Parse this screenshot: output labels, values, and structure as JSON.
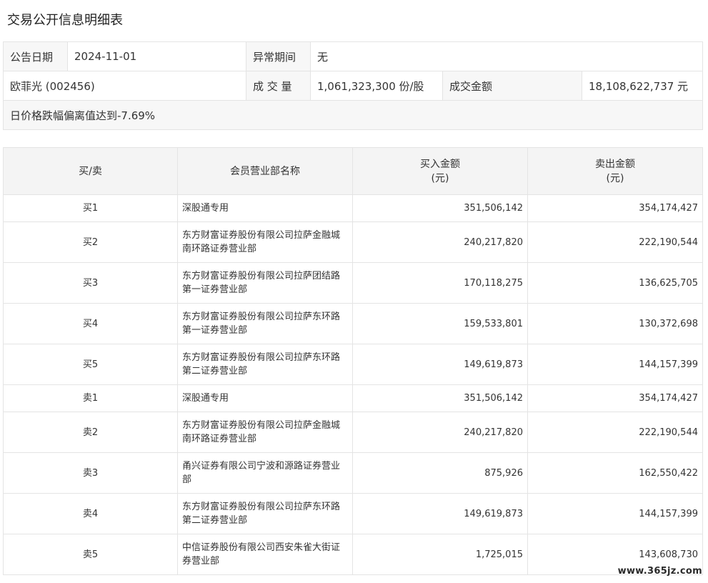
{
  "page_title": "交易公开信息明细表",
  "summary": {
    "date_label": "公告日期",
    "date_value": "2024-11-01",
    "abnormal_period_label": "异常期间",
    "abnormal_period_value": "无",
    "stock": "欧菲光 (002456)",
    "volume_label": "成 交 量",
    "volume_value": "1,061,323,300 份/股",
    "amount_label": "成交金额",
    "amount_value": "18,108,622,737 元",
    "note": "日价格跌幅偏离值达到-7.69%"
  },
  "table": {
    "headers": {
      "side": "买/卖",
      "member": "会员营业部名称",
      "buy_line1": "买入金额",
      "buy_line2": "(元)",
      "sell_line1": "卖出金额",
      "sell_line2": "(元)"
    },
    "rows": [
      {
        "side": "买1",
        "name": "深股通专用",
        "buy": "351,506,142",
        "sell": "354,174,427"
      },
      {
        "side": "买2",
        "name": "东方财富证券股份有限公司拉萨金融城南环路证券营业部",
        "buy": "240,217,820",
        "sell": "222,190,544"
      },
      {
        "side": "买3",
        "name": "东方财富证券股份有限公司拉萨团结路第一证券营业部",
        "buy": "170,118,275",
        "sell": "136,625,705"
      },
      {
        "side": "买4",
        "name": "东方财富证券股份有限公司拉萨东环路第一证券营业部",
        "buy": "159,533,801",
        "sell": "130,372,698"
      },
      {
        "side": "买5",
        "name": "东方财富证券股份有限公司拉萨东环路第二证券营业部",
        "buy": "149,619,873",
        "sell": "144,157,399"
      },
      {
        "side": "卖1",
        "name": "深股通专用",
        "buy": "351,506,142",
        "sell": "354,174,427"
      },
      {
        "side": "卖2",
        "name": "东方财富证券股份有限公司拉萨金融城南环路证券营业部",
        "buy": "240,217,820",
        "sell": "222,190,544"
      },
      {
        "side": "卖3",
        "name": "甬兴证券有限公司宁波和源路证券营业部",
        "buy": "875,926",
        "sell": "162,550,422"
      },
      {
        "side": "卖4",
        "name": "东方财富证券股份有限公司拉萨东环路第二证券营业部",
        "buy": "149,619,873",
        "sell": "144,157,399"
      },
      {
        "side": "卖5",
        "name": "中信证券股份有限公司西安朱雀大街证券营业部",
        "buy": "1,725,015",
        "sell": "143,608,730"
      }
    ]
  },
  "watermark": "www.365jz.com"
}
